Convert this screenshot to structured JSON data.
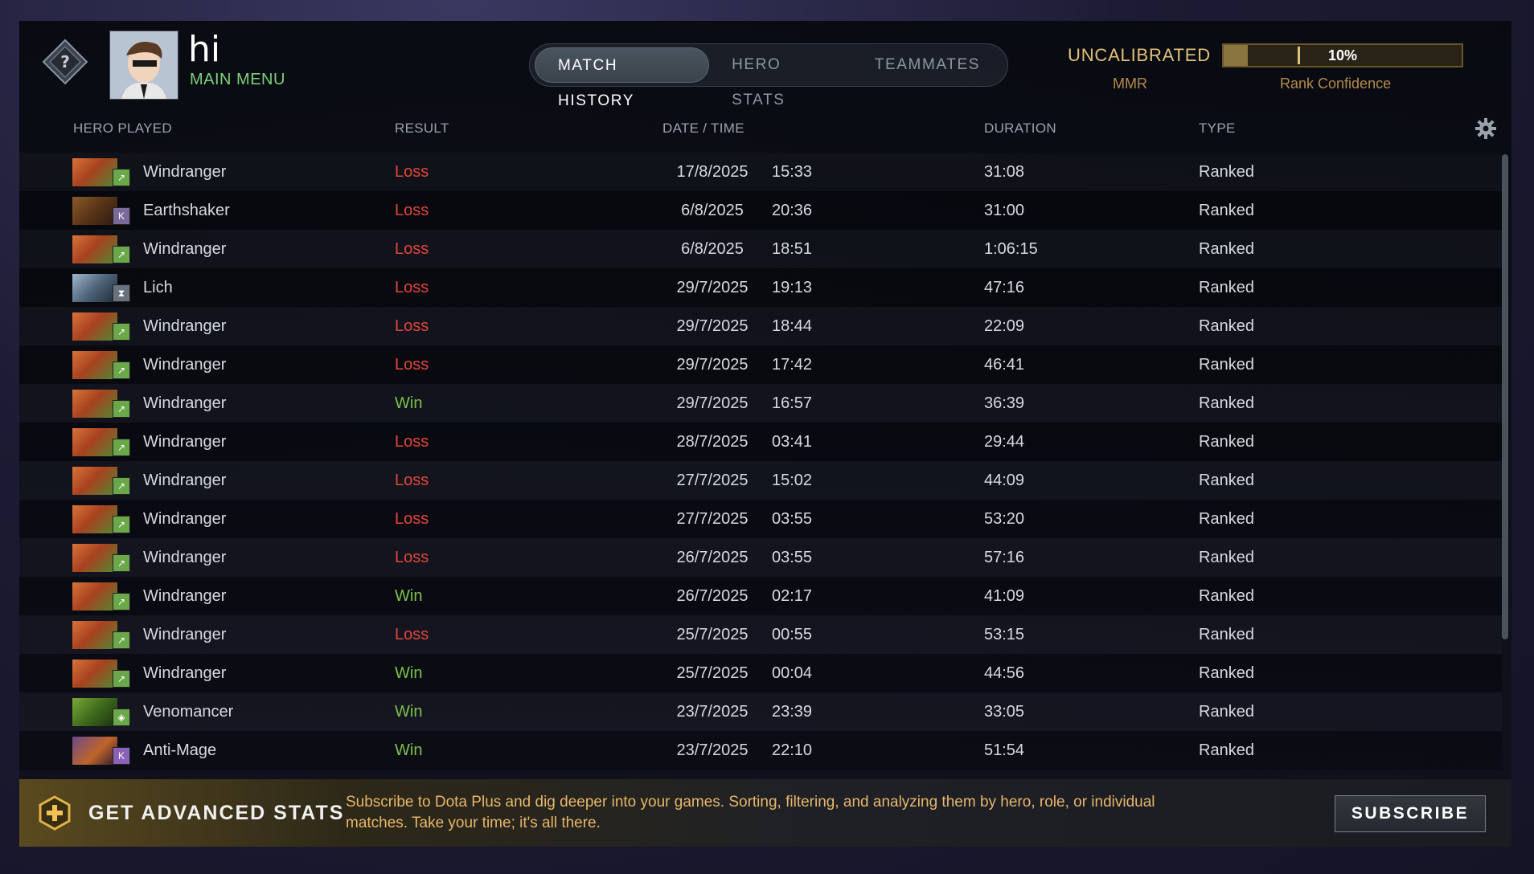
{
  "player": {
    "name": "hi",
    "main_menu": "MAIN MENU"
  },
  "tabs": [
    {
      "label": "MATCH HISTORY",
      "active": true
    },
    {
      "label": "HERO STATS",
      "active": false
    },
    {
      "label": "TEAMMATES",
      "active": false
    }
  ],
  "rank": {
    "status": "UNCALIBRATED",
    "mmr_label": "MMR",
    "confidence_value": "10%",
    "confidence_fraction": 0.1,
    "confidence_label": "Rank Confidence"
  },
  "columns": {
    "hero": "HERO PLAYED",
    "result": "RESULT",
    "datetime": "DATE / TIME",
    "duration": "DURATION",
    "type": "TYPE"
  },
  "matches": [
    {
      "hero": "Windranger",
      "result": "Loss",
      "date": "17/8/2025",
      "time": "15:33",
      "duration": "31:08",
      "type": "Ranked"
    },
    {
      "hero": "Earthshaker",
      "result": "Loss",
      "date": "6/8/2025",
      "time": "20:36",
      "duration": "31:00",
      "type": "Ranked"
    },
    {
      "hero": "Windranger",
      "result": "Loss",
      "date": "6/8/2025",
      "time": "18:51",
      "duration": "1:06:15",
      "type": "Ranked"
    },
    {
      "hero": "Lich",
      "result": "Loss",
      "date": "29/7/2025",
      "time": "19:13",
      "duration": "47:16",
      "type": "Ranked"
    },
    {
      "hero": "Windranger",
      "result": "Loss",
      "date": "29/7/2025",
      "time": "18:44",
      "duration": "22:09",
      "type": "Ranked"
    },
    {
      "hero": "Windranger",
      "result": "Loss",
      "date": "29/7/2025",
      "time": "17:42",
      "duration": "46:41",
      "type": "Ranked"
    },
    {
      "hero": "Windranger",
      "result": "Win",
      "date": "29/7/2025",
      "time": "16:57",
      "duration": "36:39",
      "type": "Ranked"
    },
    {
      "hero": "Windranger",
      "result": "Loss",
      "date": "28/7/2025",
      "time": "03:41",
      "duration": "29:44",
      "type": "Ranked"
    },
    {
      "hero": "Windranger",
      "result": "Loss",
      "date": "27/7/2025",
      "time": "15:02",
      "duration": "44:09",
      "type": "Ranked"
    },
    {
      "hero": "Windranger",
      "result": "Loss",
      "date": "27/7/2025",
      "time": "03:55",
      "duration": "53:20",
      "type": "Ranked"
    },
    {
      "hero": "Windranger",
      "result": "Loss",
      "date": "26/7/2025",
      "time": "03:55",
      "duration": "57:16",
      "type": "Ranked"
    },
    {
      "hero": "Windranger",
      "result": "Win",
      "date": "26/7/2025",
      "time": "02:17",
      "duration": "41:09",
      "type": "Ranked"
    },
    {
      "hero": "Windranger",
      "result": "Loss",
      "date": "25/7/2025",
      "time": "00:55",
      "duration": "53:15",
      "type": "Ranked"
    },
    {
      "hero": "Windranger",
      "result": "Win",
      "date": "25/7/2025",
      "time": "00:04",
      "duration": "44:56",
      "type": "Ranked"
    },
    {
      "hero": "Venomancer",
      "result": "Win",
      "date": "23/7/2025",
      "time": "23:39",
      "duration": "33:05",
      "type": "Ranked"
    },
    {
      "hero": "Anti-Mage",
      "result": "Win",
      "date": "23/7/2025",
      "time": "22:10",
      "duration": "51:54",
      "type": "Ranked"
    }
  ],
  "banner": {
    "title": "GET ADVANCED STATS",
    "text": "Subscribe to Dota Plus and dig deeper into your games. Sorting, filtering, and analyzing them by hero, role, or individual matches. Take your time; it's all there.",
    "button": "SUBSCRIBE"
  },
  "colors": {
    "loss": "#e0463a",
    "win": "#7cc24a",
    "accent_gold": "#e2c17a",
    "menu_green": "#7fd07a"
  }
}
